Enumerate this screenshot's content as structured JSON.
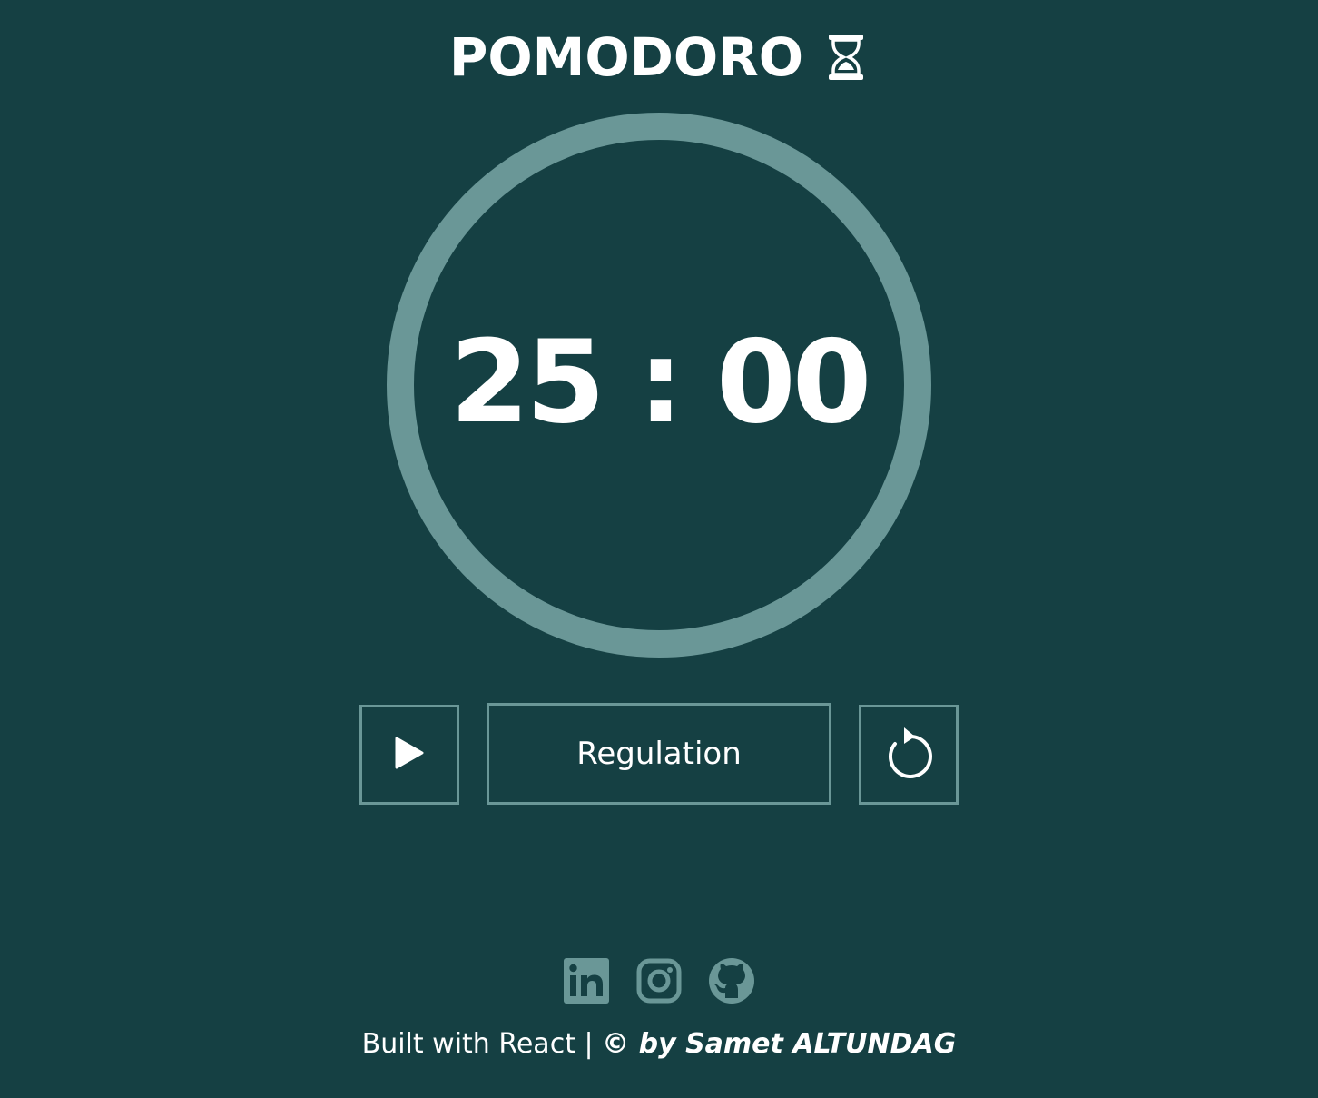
{
  "header": {
    "title": "POMODORO",
    "title_icon": "hourglass-icon"
  },
  "timer": {
    "minutes": "25",
    "separator": ":",
    "seconds": "00",
    "display": "25 : 00",
    "progress": 1.0,
    "ring_color": "#6a9797"
  },
  "controls": {
    "play_icon": "play-icon",
    "regulation_label": "Regulation",
    "reset_icon": "reset-icon"
  },
  "social": {
    "links": [
      {
        "icon": "linkedin-icon"
      },
      {
        "icon": "instagram-icon"
      },
      {
        "icon": "github-icon"
      }
    ]
  },
  "footer": {
    "built_with": "Built with React |",
    "author": "© by Samet ALTUNDAG"
  },
  "colors": {
    "background": "#154043",
    "accent": "#6a9797",
    "text": "#ffffff"
  }
}
